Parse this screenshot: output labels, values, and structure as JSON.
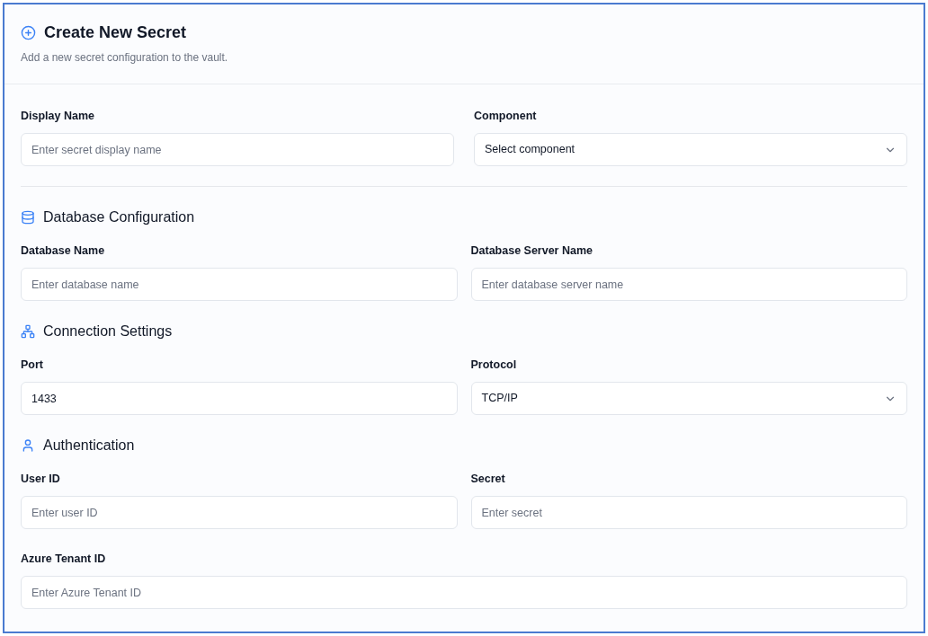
{
  "header": {
    "title": "Create New Secret",
    "subtitle": "Add a new secret configuration to the vault."
  },
  "general_fields": [
    {
      "label": "Display Name",
      "kind": "input",
      "placeholder": "Enter secret display name"
    },
    {
      "label": "Component",
      "kind": "select",
      "value": "Select component"
    }
  ],
  "sections": [
    {
      "title": "Database Configuration",
      "fields": [
        {
          "label": "Database Name",
          "kind": "input",
          "placeholder": "Enter database name"
        },
        {
          "label": "Database Server Name",
          "kind": "input",
          "placeholder": "Enter database server name"
        }
      ]
    },
    {
      "title": "Connection Settings",
      "fields": [
        {
          "label": "Port",
          "kind": "input",
          "value": "1433"
        },
        {
          "label": "Protocol",
          "kind": "select",
          "value": "TCP/IP"
        }
      ]
    },
    {
      "title": "Authentication",
      "fields": [
        {
          "label": "User ID",
          "kind": "input",
          "placeholder": "Enter user ID"
        },
        {
          "label": "Secret",
          "kind": "input",
          "placeholder": "Enter secret"
        }
      ]
    }
  ],
  "tenant_field": {
    "label": "Azure Tenant ID",
    "kind": "input",
    "placeholder": "Enter Azure Tenant ID"
  }
}
